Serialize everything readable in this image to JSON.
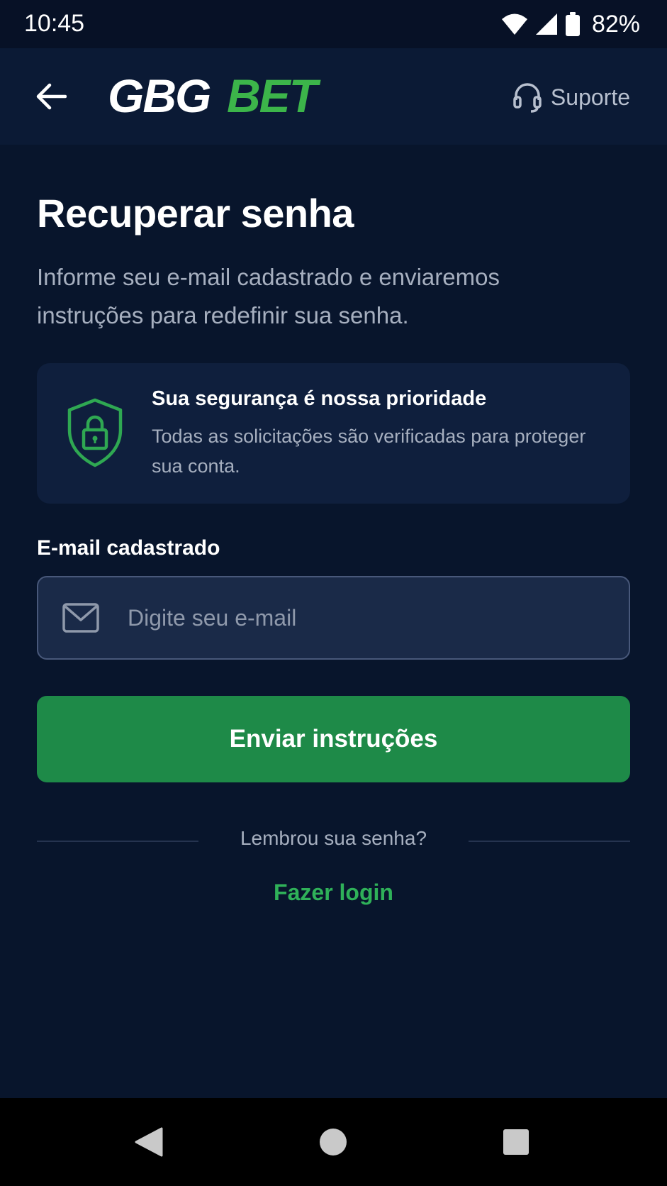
{
  "status_bar": {
    "time": "10:45",
    "battery": "82%",
    "icons": [
      "wifi-icon",
      "signal-icon",
      "battery-icon"
    ]
  },
  "header": {
    "logo_text_white": "GBG",
    "logo_text_green": "BET",
    "support_label": "Suporte",
    "icons": [
      "back-arrow-icon",
      "headset-icon"
    ]
  },
  "page": {
    "title": "Recuperar senha",
    "subtitle": "Informe seu e-mail cadastrado e enviaremos instruções para redefinir sua senha."
  },
  "info_card": {
    "title": "Sua segurança é nossa prioridade",
    "text": "Todas as solicitações são verificadas para proteger sua conta.",
    "icon": "shield-lock-icon"
  },
  "form": {
    "email_label": "E-mail cadastrado",
    "email_placeholder": "Digite seu e-mail",
    "email_value": "",
    "submit_label": "Enviar instruções"
  },
  "footer": {
    "divider_text": "Lembrou sua senha?",
    "login_link": "Fazer login"
  },
  "colors": {
    "background": "#08152c",
    "header": "#0b1a35",
    "card": "#0f1f3d",
    "accent_green": "#1e8a48",
    "link_green": "#2fb159",
    "text_muted": "#a6afbf"
  }
}
